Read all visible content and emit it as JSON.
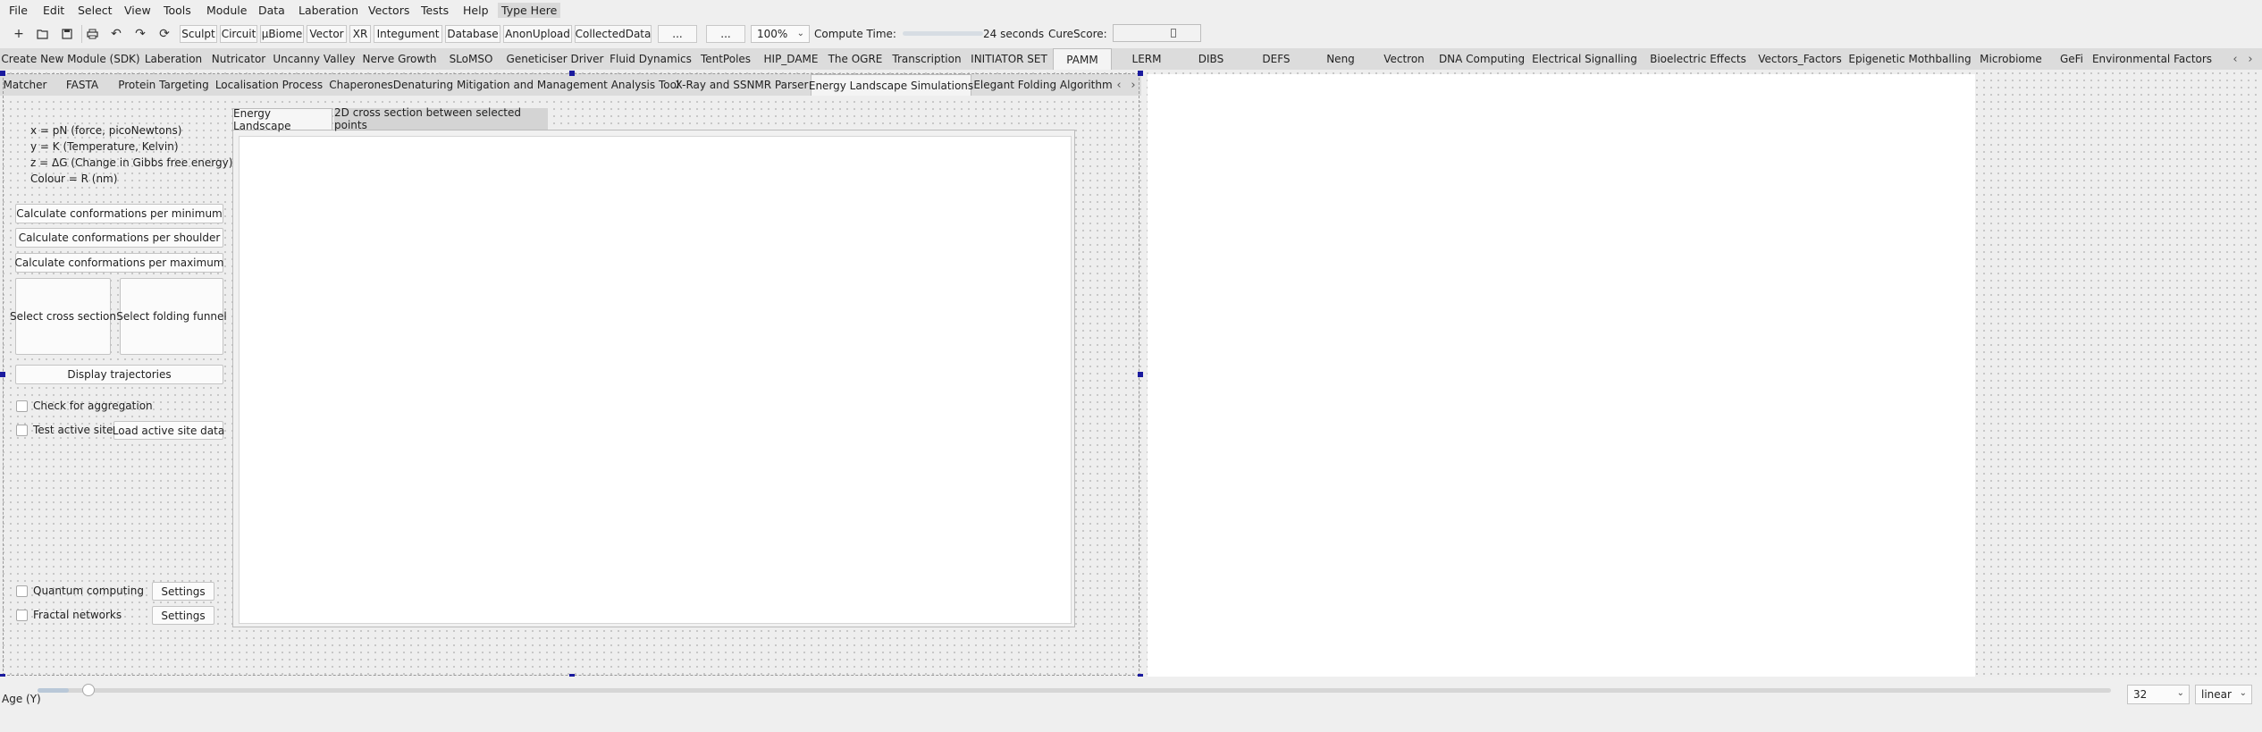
{
  "menu": {
    "items": [
      "File",
      "Edit",
      "Select",
      "View",
      "Tools",
      "Module",
      "Data",
      "Laberation",
      "Vectors",
      "Tests",
      "Help"
    ],
    "type_here": "Type Here"
  },
  "toolbar": {
    "icons": [
      "new-icon",
      "open-icon",
      "save-icon",
      "print-icon",
      "undo-icon",
      "redo-icon",
      "refresh-icon"
    ],
    "buttons": [
      "Sculpt",
      "Circuit",
      "µBiome",
      "Vector",
      "XR",
      "Integument",
      "Database",
      "AnonUpload",
      "CollectedData",
      "...",
      "..."
    ],
    "zoom": "100%",
    "compute_label": "Compute Time:",
    "compute_value": "24 seconds",
    "curescore_label": "CureScore:"
  },
  "module_tabs": [
    "Create New Module (SDK)",
    "Laberation",
    "Nutricator",
    "Uncanny Valley",
    "Nerve Growth",
    "SLoMSO",
    "Geneticiser Driver",
    "Fluid Dynamics",
    "TentPoles",
    "HIP_DAME",
    "The OGRE",
    "Transcription",
    "INITIATOR SET",
    "PAMM",
    "LERM",
    "DIBS",
    "DEFS",
    "Neng",
    "Vectron",
    "DNA Computing",
    "Electrical Signalling",
    "Bioelectric Effects",
    "Vectors_Factors",
    "Epigenetic Mothballing",
    "Microbiome",
    "GeFi",
    "Environmental Factors"
  ],
  "active_module_tab": "PAMM",
  "sub_tabs": [
    "Matcher",
    "FASTA",
    "Protein Targeting",
    "Localisation Process",
    "Chaperones",
    "Denaturing Mitigation and Management Analysis Tool",
    "X-Ray and SSNMR Parser",
    "Energy Landscape Simulations",
    "Elegant Folding Algorithm"
  ],
  "active_sub_tab": "Energy Landscape Simulations",
  "legend": {
    "x": "x = pN (force, picoNewtons)",
    "y": "y = K (Temperature, Kelvin)",
    "z": "z = ΔG (Change in Gibbs free energy)",
    "colour": "Colour = R (nm)"
  },
  "buttons": {
    "per_minimum": "Calculate conformations per minimum",
    "per_shoulder": "Calculate conformations per shoulder",
    "per_maximum": "Calculate conformations per maximum",
    "cross_section": "Select cross section",
    "folding_funnel": "Select folding funnel",
    "trajectories": "Display trajectories",
    "load_active": "Load active site data",
    "settings": "Settings"
  },
  "checks": {
    "aggregation": "Check for aggregation",
    "active_sites": "Test active sites",
    "quantum": "Quantum computing",
    "fractal": "Fractal networks"
  },
  "plot_tabs": [
    "Energy Landscape",
    "2D cross section between selected points"
  ],
  "active_plot_tab": "Energy Landscape",
  "footer": {
    "age_label": "Age (Y)",
    "age_value": "32",
    "scale": "linear",
    "age_slider_fraction": 0.015
  }
}
